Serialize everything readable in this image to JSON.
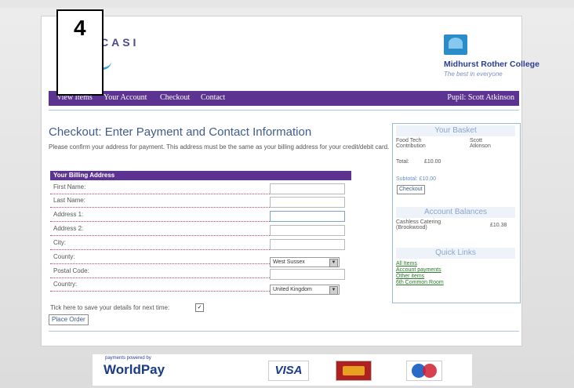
{
  "step_label": "4",
  "brand": {
    "logo_text": "CASI",
    "college_name": "Midhurst Rother College",
    "college_tagline": "The best in everyone"
  },
  "nav": {
    "items": [
      "View Items",
      "Your Account",
      "Checkout",
      "Contact"
    ],
    "pupil": "Pupil: Scott Atkinson"
  },
  "page": {
    "title": "Checkout: Enter Payment and Contact Information",
    "instructions": "Please confirm your address for payment. This address must be the same as your billing address for your credit/debit card."
  },
  "billing": {
    "header": "Your Billing Address",
    "fields": [
      {
        "label": "First Name:",
        "value": ""
      },
      {
        "label": "Last Name:",
        "value": ""
      },
      {
        "label": "Address 1:",
        "value": ""
      },
      {
        "label": "Address 2:",
        "value": ""
      },
      {
        "label": "City:",
        "value": ""
      },
      {
        "label": "County:",
        "value": "West Sussex"
      },
      {
        "label": "Postal Code:",
        "value": ""
      },
      {
        "label": "Country:",
        "value": "United Kingdom"
      }
    ],
    "save_text": "Tick here to save your details for next time:",
    "save_checked": true,
    "place_order": "Place Order"
  },
  "basket": {
    "title": "Your Basket",
    "item_name": "Food Tech Contribution",
    "item_for": "Scott Atkinson",
    "total_label": "Total:",
    "total_value": "£10.00",
    "subtotal": "Subtotal: £10.00",
    "checkout_button": "Checkout"
  },
  "balances": {
    "title": "Account Balances",
    "account_name": "Cashless Catering (Brookwood)",
    "account_value": "£10.38"
  },
  "quick_links": {
    "title": "Quick Links",
    "items": [
      "All Items",
      "Account payments",
      "Other items",
      "6th Common Room"
    ]
  },
  "footer": {
    "worldpay_small": "payments powered by",
    "worldpay_big": "WorldPay",
    "visa": "VISA"
  },
  "colors": {
    "nav_purple": "#5c3390",
    "heading_blue": "#3f5c8a",
    "link_green": "#2a7a2a"
  }
}
